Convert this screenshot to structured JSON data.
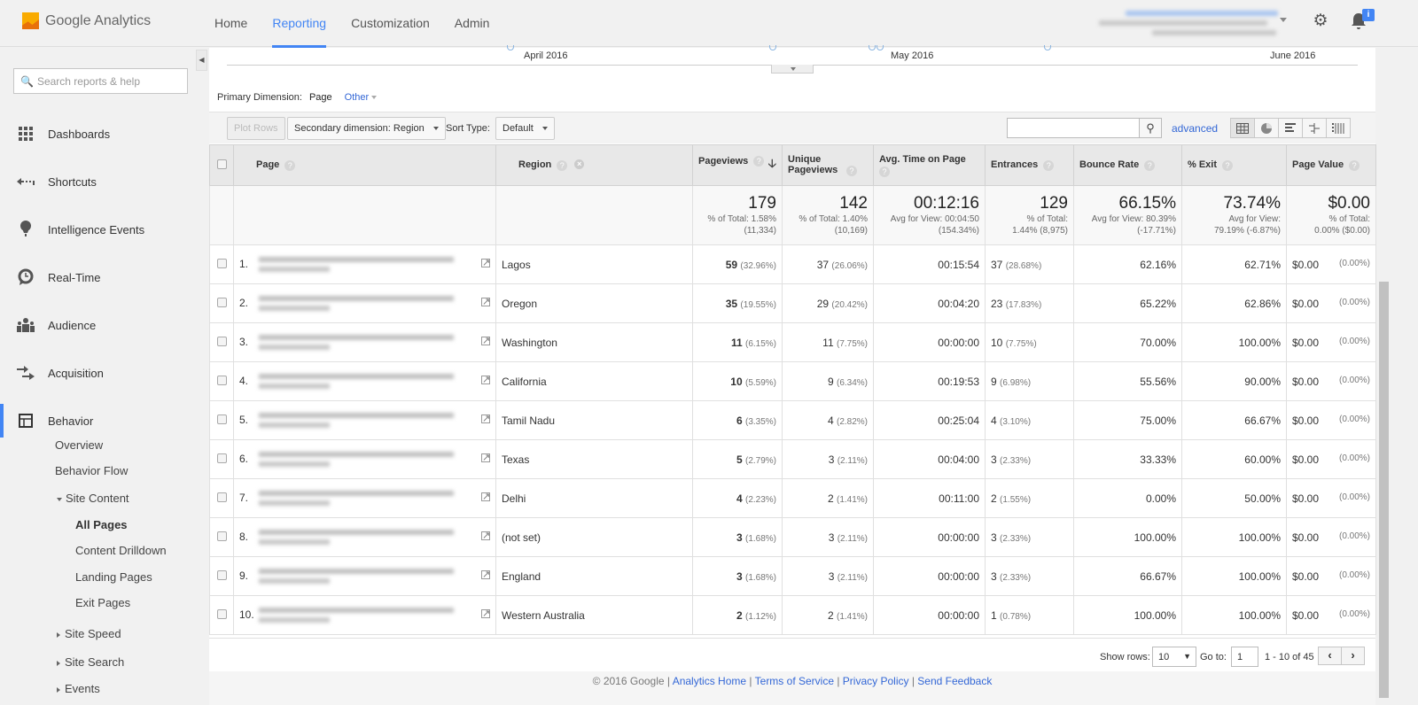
{
  "app": {
    "name": "Google Analytics"
  },
  "topnav": {
    "items": [
      {
        "label": "Home",
        "active": false
      },
      {
        "label": "Reporting",
        "active": true
      },
      {
        "label": "Customization",
        "active": false
      },
      {
        "label": "Admin",
        "active": false
      }
    ]
  },
  "icons": {
    "gear": "⚙",
    "bell": "🔔",
    "bell_badge": "i"
  },
  "sidebar": {
    "search_placeholder": "Search reports & help",
    "items": [
      {
        "label": "Dashboards",
        "icon": "grid-icon"
      },
      {
        "label": "Shortcuts",
        "icon": "shortcut-arrow-icon"
      },
      {
        "label": "Intelligence Events",
        "icon": "lightbulb-icon"
      },
      {
        "label": "Real-Time",
        "icon": "clock-icon"
      },
      {
        "label": "Audience",
        "icon": "people-icon"
      },
      {
        "label": "Acquisition",
        "icon": "acquisition-arrows-icon"
      },
      {
        "label": "Behavior",
        "icon": "layout-icon"
      }
    ],
    "behavior_sub": {
      "overview": "Overview",
      "flow": "Behavior Flow",
      "site_content": "Site Content",
      "all_pages": "All Pages",
      "content_drilldown": "Content Drilldown",
      "landing_pages": "Landing Pages",
      "exit_pages": "Exit Pages",
      "site_speed": "Site Speed",
      "site_search": "Site Search",
      "events": "Events"
    }
  },
  "timeline": {
    "labels": [
      "April 2016",
      "May 2016",
      "June 2016"
    ]
  },
  "primary_dimension": {
    "label": "Primary Dimension:",
    "current": "Page",
    "other": "Other"
  },
  "toolbar": {
    "plot_rows": "Plot Rows",
    "secondary_dimension": "Secondary dimension: Region",
    "sort_type_label": "Sort Type:",
    "sort_type_value": "Default",
    "search_value": "",
    "advanced": "advanced"
  },
  "table": {
    "headers": {
      "page": "Page",
      "region": "Region",
      "pageviews": "Pageviews",
      "unique_pageviews": "Unique Pageviews",
      "avg_time": "Avg. Time on Page",
      "entrances": "Entrances",
      "bounce_rate": "Bounce Rate",
      "exit": "% Exit",
      "page_value": "Page Value"
    },
    "totals": {
      "pageviews": {
        "value": "179",
        "sub1": "% of Total: 1.58%",
        "sub2": "(11,334)"
      },
      "unique_pageviews": {
        "value": "142",
        "sub1": "% of Total: 1.40%",
        "sub2": "(10,169)"
      },
      "avg_time": {
        "value": "00:12:16",
        "sub1": "Avg for View: 00:04:50",
        "sub2": "(154.34%)"
      },
      "entrances": {
        "value": "129",
        "sub1": "% of Total:",
        "sub2": "1.44% (8,975)"
      },
      "bounce_rate": {
        "value": "66.15%",
        "sub1": "Avg for View: 80.39%",
        "sub2": "(-17.71%)"
      },
      "exit": {
        "value": "73.74%",
        "sub1": "Avg for View:",
        "sub2": "79.19% (-6.87%)"
      },
      "page_value": {
        "value": "$0.00",
        "sub1": "% of Total:",
        "sub2": "0.00% ($0.00)"
      }
    },
    "rows": [
      {
        "n": "1.",
        "region": "Lagos",
        "pv": "59",
        "pv_pct": "(32.96%)",
        "upv": "37",
        "upv_pct": "(26.06%)",
        "time": "00:15:54",
        "ent": "37",
        "ent_pct": "(28.68%)",
        "bounce": "62.16%",
        "exit": "62.71%",
        "val": "$0.00",
        "val_pct": "(0.00%)"
      },
      {
        "n": "2.",
        "region": "Oregon",
        "pv": "35",
        "pv_pct": "(19.55%)",
        "upv": "29",
        "upv_pct": "(20.42%)",
        "time": "00:04:20",
        "ent": "23",
        "ent_pct": "(17.83%)",
        "bounce": "65.22%",
        "exit": "62.86%",
        "val": "$0.00",
        "val_pct": "(0.00%)"
      },
      {
        "n": "3.",
        "region": "Washington",
        "pv": "11",
        "pv_pct": "(6.15%)",
        "upv": "11",
        "upv_pct": "(7.75%)",
        "time": "00:00:00",
        "ent": "10",
        "ent_pct": "(7.75%)",
        "bounce": "70.00%",
        "exit": "100.00%",
        "val": "$0.00",
        "val_pct": "(0.00%)"
      },
      {
        "n": "4.",
        "region": "California",
        "pv": "10",
        "pv_pct": "(5.59%)",
        "upv": "9",
        "upv_pct": "(6.34%)",
        "time": "00:19:53",
        "ent": "9",
        "ent_pct": "(6.98%)",
        "bounce": "55.56%",
        "exit": "90.00%",
        "val": "$0.00",
        "val_pct": "(0.00%)"
      },
      {
        "n": "5.",
        "region": "Tamil Nadu",
        "pv": "6",
        "pv_pct": "(3.35%)",
        "upv": "4",
        "upv_pct": "(2.82%)",
        "time": "00:25:04",
        "ent": "4",
        "ent_pct": "(3.10%)",
        "bounce": "75.00%",
        "exit": "66.67%",
        "val": "$0.00",
        "val_pct": "(0.00%)"
      },
      {
        "n": "6.",
        "region": "Texas",
        "pv": "5",
        "pv_pct": "(2.79%)",
        "upv": "3",
        "upv_pct": "(2.11%)",
        "time": "00:04:00",
        "ent": "3",
        "ent_pct": "(2.33%)",
        "bounce": "33.33%",
        "exit": "60.00%",
        "val": "$0.00",
        "val_pct": "(0.00%)"
      },
      {
        "n": "7.",
        "region": "Delhi",
        "pv": "4",
        "pv_pct": "(2.23%)",
        "upv": "2",
        "upv_pct": "(1.41%)",
        "time": "00:11:00",
        "ent": "2",
        "ent_pct": "(1.55%)",
        "bounce": "0.00%",
        "exit": "50.00%",
        "val": "$0.00",
        "val_pct": "(0.00%)"
      },
      {
        "n": "8.",
        "region": "(not set)",
        "pv": "3",
        "pv_pct": "(1.68%)",
        "upv": "3",
        "upv_pct": "(2.11%)",
        "time": "00:00:00",
        "ent": "3",
        "ent_pct": "(2.33%)",
        "bounce": "100.00%",
        "exit": "100.00%",
        "val": "$0.00",
        "val_pct": "(0.00%)"
      },
      {
        "n": "9.",
        "region": "England",
        "pv": "3",
        "pv_pct": "(1.68%)",
        "upv": "3",
        "upv_pct": "(2.11%)",
        "time": "00:00:00",
        "ent": "3",
        "ent_pct": "(2.33%)",
        "bounce": "66.67%",
        "exit": "100.00%",
        "val": "$0.00",
        "val_pct": "(0.00%)"
      },
      {
        "n": "10.",
        "region": "Western Australia",
        "pv": "2",
        "pv_pct": "(1.12%)",
        "upv": "2",
        "upv_pct": "(1.41%)",
        "time": "00:00:00",
        "ent": "1",
        "ent_pct": "(0.78%)",
        "bounce": "100.00%",
        "exit": "100.00%",
        "val": "$0.00",
        "val_pct": "(0.00%)"
      }
    ]
  },
  "pager": {
    "show_rows_label": "Show rows:",
    "show_rows_value": "10",
    "goto_label": "Go to:",
    "goto_value": "1",
    "range": "1 - 10 of 45",
    "prev": "‹",
    "next": "›"
  },
  "footer": {
    "copyright": "© 2016 Google",
    "links": [
      "Analytics Home",
      "Terms of Service",
      "Privacy Policy",
      "Send Feedback"
    ]
  }
}
